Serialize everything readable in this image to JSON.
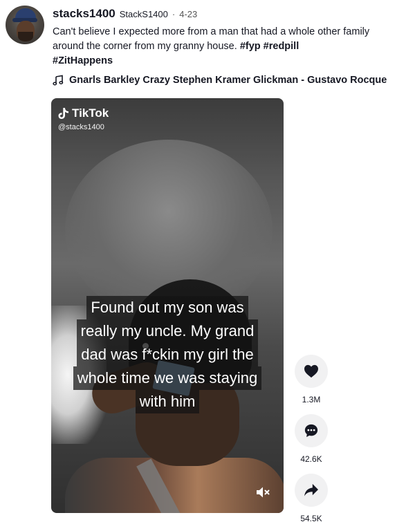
{
  "author": {
    "username": "stacks1400",
    "nickname": "StackS1400",
    "separator": "·",
    "date": "4-23"
  },
  "caption": {
    "text": "Can't believe I expected more from a man that had a whole other family around the corner from my granny house.",
    "hashtags": [
      "#fyp",
      "#redpill",
      "#ZitHappens"
    ]
  },
  "music": {
    "icon": "music-note-icon",
    "title": "Gnarls Barkley Crazy Stephen Kramer Glickman - Gustavo Rocque"
  },
  "video": {
    "watermark_brand": "TikTok",
    "watermark_handle": "@stacks1400",
    "overlay_lines": [
      "Found out my son was",
      "really my uncle. My grand",
      "dad was f*ckin my girl the",
      "whole time we was staying",
      "with him"
    ],
    "mute_icon": "speaker-muted-icon"
  },
  "actions": {
    "likes": "1.3M",
    "comments": "42.6K",
    "shares": "54.5K"
  }
}
